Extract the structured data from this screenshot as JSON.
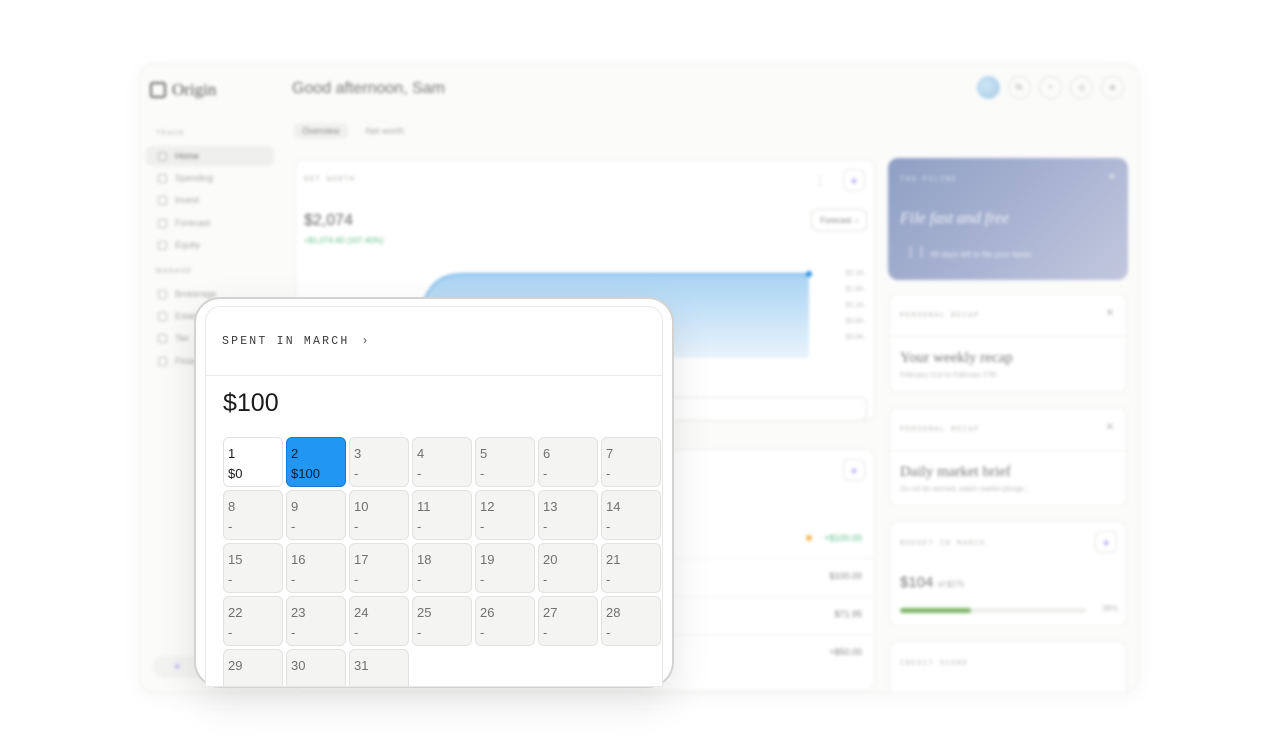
{
  "app": {
    "logo": "Origin",
    "greeting": "Good afternoon, Sam",
    "avatar_initials": "SL",
    "sidebar": {
      "section_main": "Track",
      "items_main": [
        "Home",
        "Spending",
        "Invest",
        "Forecast",
        "Equity"
      ],
      "section_manage": "Manage",
      "items_manage": [
        "Brokerage",
        "Estate",
        "Tax",
        "Financial"
      ],
      "add_label": "+"
    },
    "tabs": [
      "Overview",
      "Net worth"
    ],
    "net_worth": {
      "label": "NET WORTH",
      "value": "$2,074",
      "change": "+$1,074.40 (107.40%)",
      "forecast_label": "Forecast",
      "ticks": [
        "$2.1K",
        "$1.6K",
        "$1.1K",
        "$0.6K",
        "$0.0K"
      ]
    },
    "transactions": {
      "values": [
        "+$100.00",
        "$100.00",
        "$71.95",
        "+$50.00"
      ]
    },
    "promo": {
      "label": "TAX FILING",
      "title": "File fast and free",
      "subtitle": "All days left to file your taxes"
    },
    "recaps": [
      {
        "label": "PERSONAL RECAP",
        "title": "Your weekly recap",
        "subtitle": "February 21st to February 27th"
      },
      {
        "label": "PERSONAL RECAP",
        "title": "Daily market brief",
        "subtitle": "Do not be worried, watch market plunge..."
      }
    ],
    "budget": {
      "label": "BUDGET IN MARCH",
      "value": "$104",
      "of": "of $275",
      "percent": "38%",
      "fill_fraction": 0.38
    },
    "score_label": "CREDIT SCORE"
  },
  "popup": {
    "title": "SPENT IN MARCH",
    "chevron": "›",
    "total": "$100",
    "selected_day": 2,
    "days": [
      {
        "day": "1",
        "amount": "$0"
      },
      {
        "day": "2",
        "amount": "$100"
      },
      {
        "day": "3",
        "amount": "-"
      },
      {
        "day": "4",
        "amount": "-"
      },
      {
        "day": "5",
        "amount": "-"
      },
      {
        "day": "6",
        "amount": "-"
      },
      {
        "day": "7",
        "amount": "-"
      },
      {
        "day": "8",
        "amount": "-"
      },
      {
        "day": "9",
        "amount": "-"
      },
      {
        "day": "10",
        "amount": "-"
      },
      {
        "day": "11",
        "amount": "-"
      },
      {
        "day": "12",
        "amount": "-"
      },
      {
        "day": "13",
        "amount": "-"
      },
      {
        "day": "14",
        "amount": "-"
      },
      {
        "day": "15",
        "amount": "-"
      },
      {
        "day": "16",
        "amount": "-"
      },
      {
        "day": "17",
        "amount": "-"
      },
      {
        "day": "18",
        "amount": "-"
      },
      {
        "day": "19",
        "amount": "-"
      },
      {
        "day": "20",
        "amount": "-"
      },
      {
        "day": "21",
        "amount": "-"
      },
      {
        "day": "22",
        "amount": "-"
      },
      {
        "day": "23",
        "amount": "-"
      },
      {
        "day": "24",
        "amount": "-"
      },
      {
        "day": "25",
        "amount": "-"
      },
      {
        "day": "26",
        "amount": "-"
      },
      {
        "day": "27",
        "amount": "-"
      },
      {
        "day": "28",
        "amount": "-"
      },
      {
        "day": "29",
        "amount": ""
      },
      {
        "day": "30",
        "amount": ""
      },
      {
        "day": "31",
        "amount": ""
      }
    ]
  },
  "colors": {
    "selected_day": "#2196f3",
    "accent": "#8b7cf6",
    "positive": "#5fbf8e",
    "budget_bar": "#7fb56a"
  }
}
